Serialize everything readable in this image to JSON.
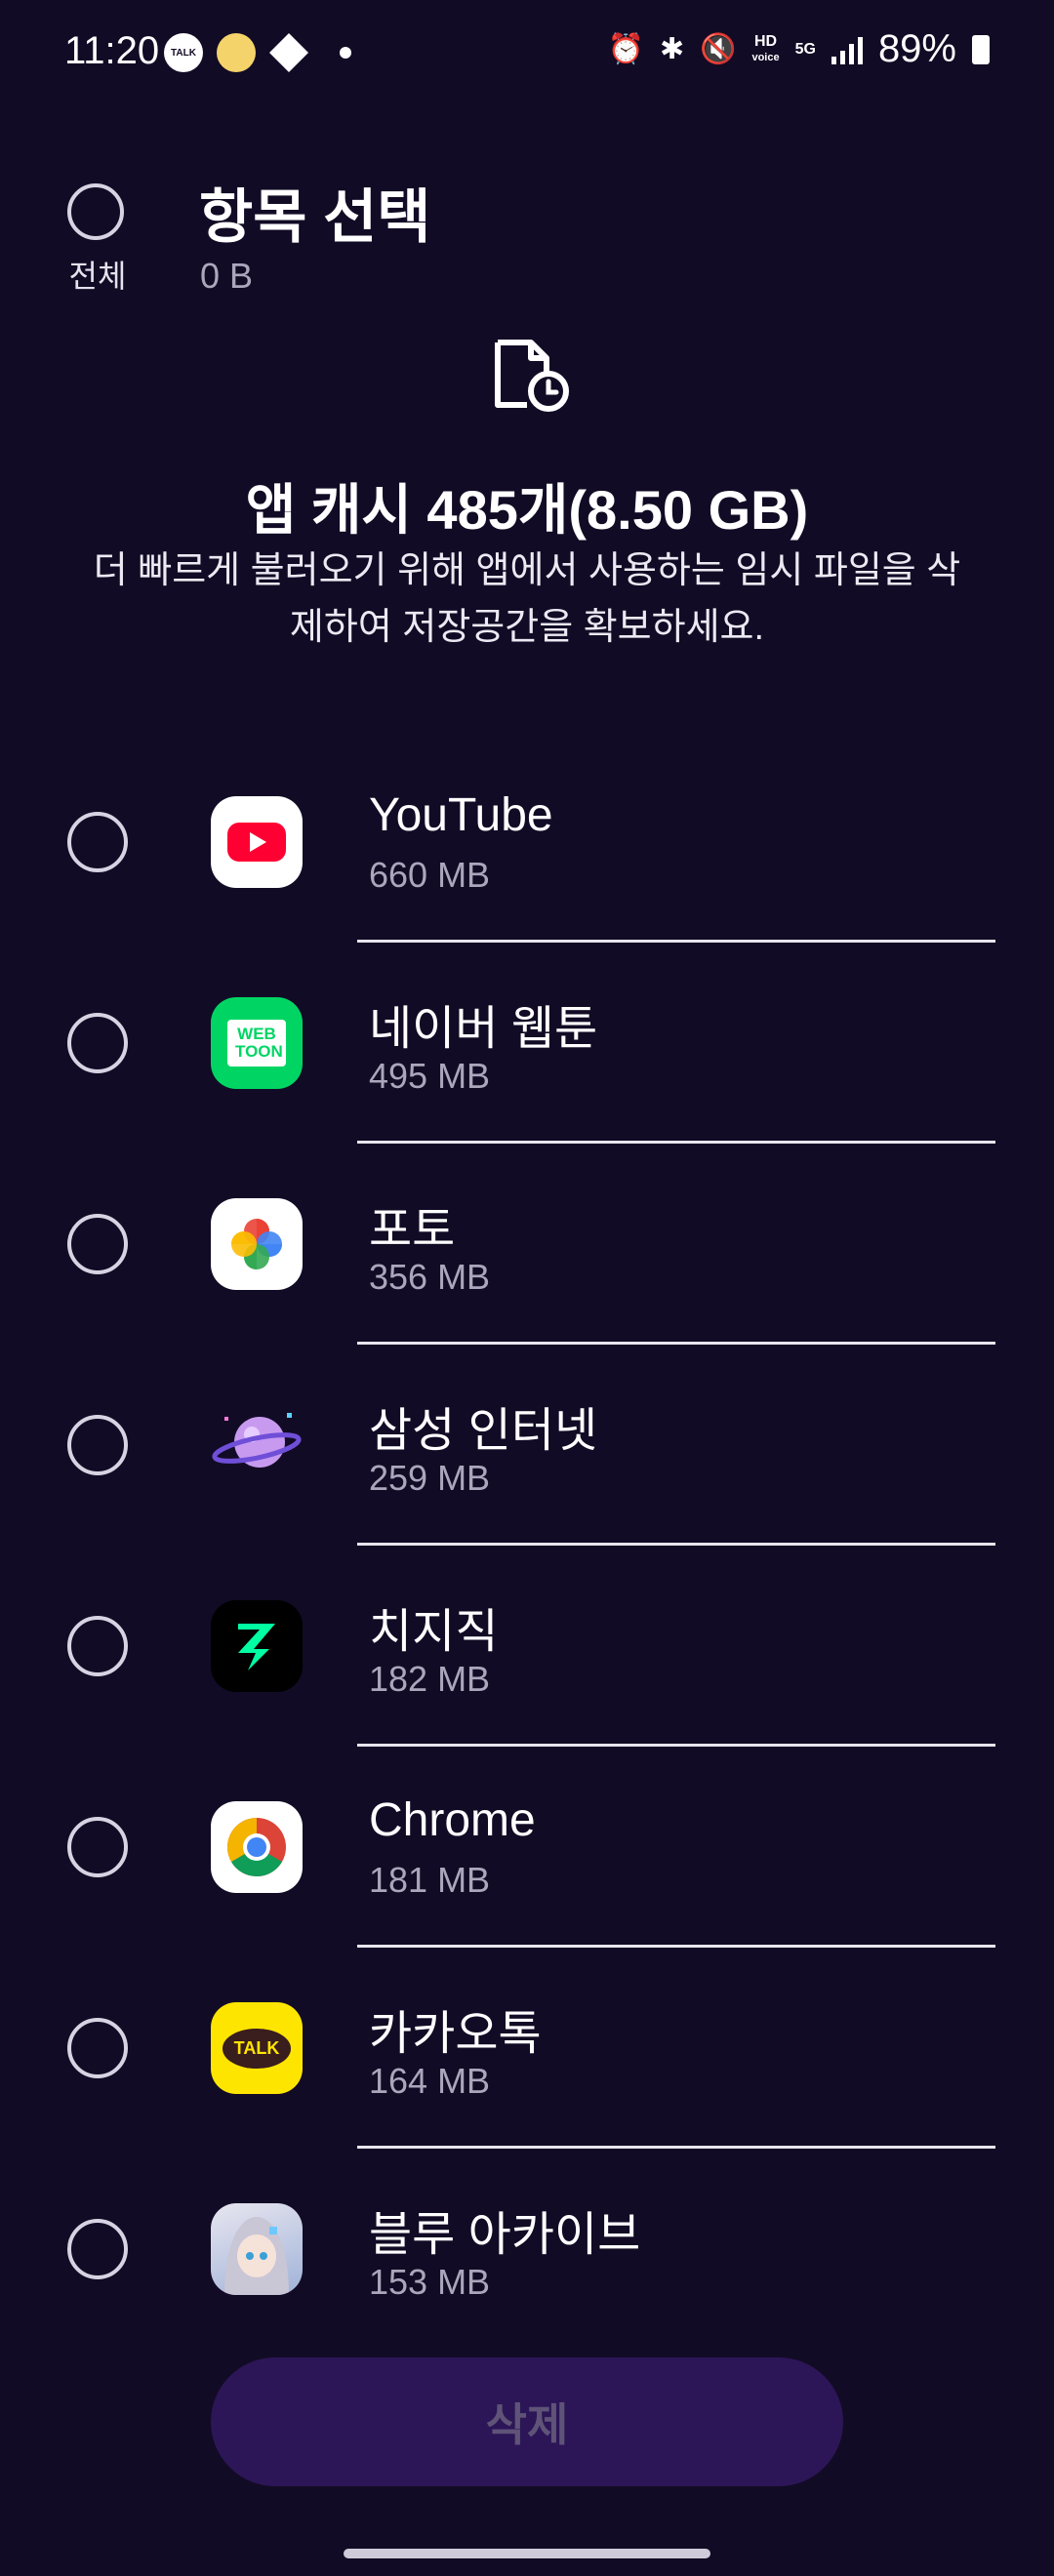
{
  "status_bar": {
    "time": "11:20",
    "notification_icons": [
      "kakaotalk-icon",
      "chick-icon",
      "swirl-icon",
      "dot-icon"
    ],
    "system_icons": [
      "alarm-icon",
      "bluetooth-icon",
      "mute-icon",
      "hd-voice-icon",
      "5g-icon",
      "signal-icon"
    ],
    "hd_label": "HD",
    "voice_label": "voice",
    "fiveg_label": "5G",
    "battery": "89%"
  },
  "header": {
    "select_all_label": "전체",
    "title": "항목 선택",
    "selected_size": "0 B"
  },
  "cache": {
    "icon": "file-clock-icon",
    "title": "앱 캐시 485개(8.50 GB)",
    "description": "더 빠르게 불러오기 위해 앱에서 사용하는 임시 파일을 삭제하여 저장공간을 확보하세요."
  },
  "apps": [
    {
      "name": "YouTube",
      "size": "660 MB",
      "icon": "youtube-icon"
    },
    {
      "name": "네이버 웹툰",
      "size": "495 MB",
      "icon": "webtoon-icon",
      "icon_text": "WEB TOON"
    },
    {
      "name": "포토",
      "size": "356 MB",
      "icon": "photos-icon"
    },
    {
      "name": "삼성 인터넷",
      "size": "259 MB",
      "icon": "samsung-internet-icon"
    },
    {
      "name": "치지직",
      "size": "182 MB",
      "icon": "chzzk-icon"
    },
    {
      "name": "Chrome",
      "size": "181 MB",
      "icon": "chrome-icon"
    },
    {
      "name": "카카오톡",
      "size": "164 MB",
      "icon": "kakaotalk-icon",
      "icon_text": "TALK"
    },
    {
      "name": "블루 아카이브",
      "size": "153 MB",
      "icon": "blue-archive-icon"
    }
  ],
  "delete_button": "삭제",
  "colors": {
    "background": "#120b25",
    "delete_button_bg": "#2c1657",
    "youtube_red": "#ff0033",
    "webtoon_green": "#00d564",
    "chzzk_green": "#00ffa3",
    "kakao_yellow": "#fee500"
  }
}
